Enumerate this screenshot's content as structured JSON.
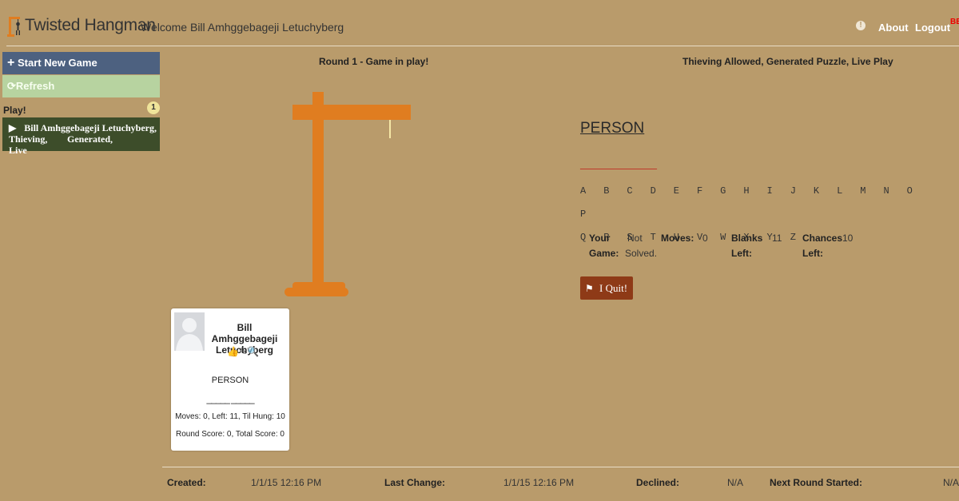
{
  "header": {
    "brand": "Twisted Hangman",
    "welcome": "Welcome Bill Amhggebageji Letuchyberg",
    "help_icon": "help-icon",
    "about_label": "About",
    "logout_label": "Logout",
    "badge_text": "BE"
  },
  "sidebar": {
    "start_label": "Start New Game",
    "refresh_label": "Refresh",
    "section_label": "Play!",
    "section_count": "1",
    "game_item_line1": "Bill Amhggebageji Letuchyberg,",
    "game_item_line2": "Thieving, Generated, Live"
  },
  "game": {
    "round_status": "Round 1 - Game in play!",
    "rules": "Thieving Allowed, Generated Puzzle, Live Play",
    "category": "PERSON",
    "blanks": "_____ ______",
    "letters_row1": [
      "A",
      "B",
      "C",
      "D",
      "E",
      "F",
      "G",
      "H",
      "I",
      "J",
      "K",
      "L",
      "M",
      "N",
      "O",
      "P"
    ],
    "letters_row2": [
      "Q",
      "R",
      "S",
      "T",
      "U",
      "V",
      "W",
      "X",
      "Y",
      "Z"
    ],
    "stats": {
      "your_game_label_1": "Your",
      "your_game_label_2": "Game:",
      "your_game_value_1": "Not",
      "your_game_value_2": "Solved.",
      "moves_label": "Moves:",
      "moves_value": "0",
      "blanks_label_1": "Blanks",
      "blanks_label_2": "Left:",
      "blanks_value": "11",
      "chances_label_1": "Chances",
      "chances_label_2": "Left:",
      "chances_value": "10"
    },
    "quit_label": "I Quit!"
  },
  "player_card": {
    "name_line1": "Bill Amhggebageji",
    "name_line2": "Letuchyberg",
    "icons": [
      "thumbs-up-icon",
      "pencil-icon",
      "search-icon"
    ],
    "category": "PERSON",
    "blanks": "_____ _____",
    "moves_line": "Moves: 0, Left: 11, Til Hung: 10",
    "score_line": "Round Score: 0, Total Score: 0"
  },
  "footer": {
    "created_label": "Created:",
    "created_value": "1/1/15 12:16 PM",
    "last_change_label": "Last Change:",
    "last_change_value": "1/1/15 12:16 PM",
    "declined_label": "Declined:",
    "declined_value": "N/A",
    "next_round_label": "Next Round Started:",
    "next_round_value": "N/A"
  },
  "colors": {
    "background": "#b99b6b",
    "gallows": "#e07d20",
    "start_button": "#4d6180",
    "refresh_button": "#b7d3a0",
    "game_item": "#3d4d2a",
    "quit_button": "#8e3a17",
    "blanks": "#c0392b"
  }
}
